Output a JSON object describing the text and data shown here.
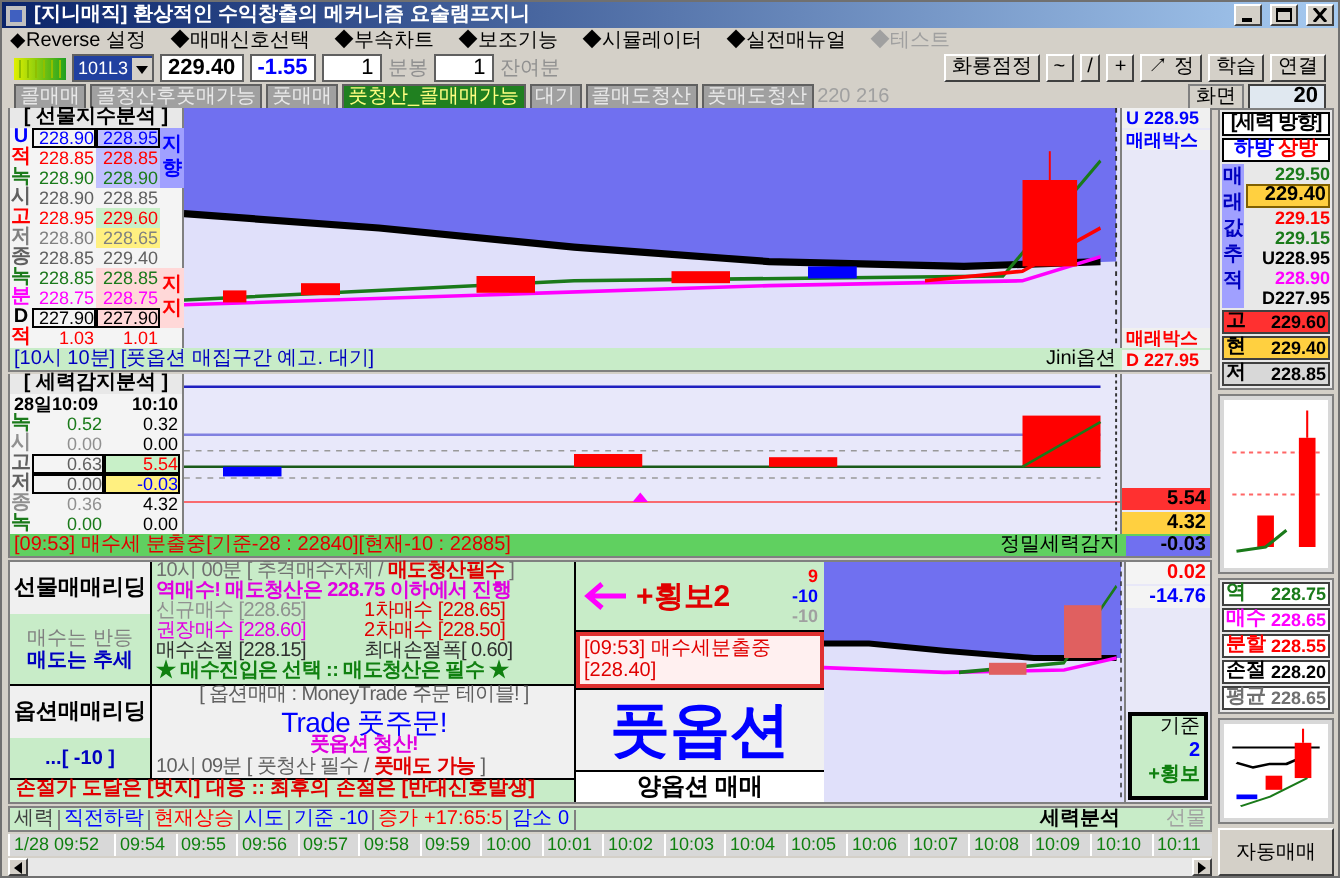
{
  "window": {
    "title": "[지니매직] 환상적인 수익창출의 메커니즘 요술램프지니"
  },
  "menu": [
    {
      "label": "◆Reverse 설정",
      "disabled": false
    },
    {
      "label": "◆매매신호선택",
      "disabled": false
    },
    {
      "label": "◆부속차트",
      "disabled": false
    },
    {
      "label": "◆보조기능",
      "disabled": false
    },
    {
      "label": "◆시뮬레이터",
      "disabled": false
    },
    {
      "label": "◆실전매뉴얼",
      "disabled": false
    },
    {
      "label": "◆테스트",
      "disabled": true
    }
  ],
  "toolbar": {
    "symbol": "101L3",
    "price": "229.40",
    "change": "-1.55",
    "interval": "1",
    "interval_unit": "분봉",
    "remaining": "1",
    "remaining_unit": "잔여분",
    "buttons": [
      "화룡점정",
      "~",
      "/",
      "+",
      "↗ 정",
      "학습",
      "연결"
    ]
  },
  "signals": {
    "items": [
      {
        "label": "콜매매",
        "selected": false
      },
      {
        "label": "콜청산후풋매가능",
        "selected": false
      },
      {
        "label": "풋매매",
        "selected": false
      },
      {
        "label": "풋청산_콜매매가능",
        "selected": true
      },
      {
        "label": "대기",
        "selected": false
      },
      {
        "label": "콜매도청산",
        "selected": false
      },
      {
        "label": "풋매도청산",
        "selected": false
      }
    ],
    "code": "220 216"
  },
  "screen": {
    "label": "화면",
    "value": "20"
  },
  "futures_panel": {
    "title": "[ 선물지수분석 ]",
    "rows": [
      {
        "label": "U",
        "values": [
          "228.90",
          "228.95"
        ],
        "color": "#0000ff"
      },
      {
        "label": "적",
        "values": [
          "228.85",
          "228.85"
        ],
        "color": "#ff0000"
      },
      {
        "label": "녹",
        "values": [
          "228.90",
          "228.90"
        ],
        "color": "#1a7a1a"
      },
      {
        "label": "시",
        "values": [
          "228.90",
          "228.85"
        ],
        "color": "#606060"
      },
      {
        "label": "고",
        "values": [
          "228.95",
          "229.60"
        ],
        "color": "#ff0000"
      },
      {
        "label": "저",
        "values": [
          "228.80",
          "228.65"
        ],
        "color": "#808080"
      },
      {
        "label": "종",
        "values": [
          "228.85",
          "229.40"
        ],
        "color": "#606060"
      },
      {
        "label": "녹",
        "values": [
          "228.85",
          "228.85"
        ],
        "color": "#1a7a1a"
      },
      {
        "label": "분",
        "values": [
          "228.75",
          "228.75"
        ],
        "color": "#ff00ff"
      },
      {
        "label": "D",
        "values": [
          "227.90",
          "227.90"
        ],
        "color": "#000000"
      },
      {
        "label": "적",
        "values": [
          "1.03",
          "1.01"
        ],
        "color": "#ff0000"
      }
    ],
    "side_labels": [
      "지향",
      "지지"
    ],
    "readings": [
      {
        "text": "U 228.95",
        "color": "#0000ff"
      },
      {
        "text": "매래박스",
        "color": "#0000ff"
      },
      {
        "text": "매래박스",
        "color": "#ff0000"
      }
    ],
    "status": "[10시 10분] [풋옵션 매집구간 예고. 대기]",
    "status_right": "Jini옵션",
    "status_reading": "D 227.95"
  },
  "force_panel": {
    "title": "[ 세력감지분석 ]",
    "header": [
      "28일10:09",
      "10:10"
    ],
    "rows": [
      {
        "label": "녹",
        "values": [
          "0.52",
          "0.32"
        ],
        "color": "#1a7a1a"
      },
      {
        "label": "시",
        "values": [
          "0.00",
          "0.00"
        ],
        "color": "#909090"
      },
      {
        "label": "고",
        "values": [
          "0.63",
          "5.54"
        ],
        "color": "#606060"
      },
      {
        "label": "저",
        "values": [
          "0.00",
          "-0.03"
        ],
        "color": "#606060"
      },
      {
        "label": "종",
        "values": [
          "0.36",
          "4.32"
        ],
        "color": "#909090"
      },
      {
        "label": "녹",
        "values": [
          "0.00",
          "0.00"
        ],
        "color": "#1a7a1a"
      }
    ],
    "readings": [
      {
        "text": "5.54",
        "color": "#ff3030"
      },
      {
        "text": "4.32",
        "color": "#ffd040"
      }
    ],
    "status": "[09:53] 매수세 분출중[기준-28 : 22840][현재-10 : 22885]",
    "status_right": "정밀세력감지",
    "status_reading": {
      "text": "-0.03",
      "color": "#7070f0"
    }
  },
  "leading": [
    {
      "title": "선물매매리딩",
      "lines": [
        "매수는 반등",
        "매도는 추세"
      ]
    },
    {
      "title": "옵션매매리딩",
      "lines": [
        "...[ -10 ]"
      ]
    }
  ],
  "futures_box": {
    "header": "10시 00분 [ 추격매수자제 / **매도청산필수** ]",
    "alert": "역매수! 매도청산은 228.75 이하에서 진행",
    "levels": [
      {
        "text": "신규매수 [228.65]",
        "color": "#909090"
      },
      {
        "text": "1차매수 [228.65]",
        "color": "#e00000"
      },
      {
        "text": "권장매수 [228.60]",
        "color": "#e000e0"
      },
      {
        "text": "2차매수 [228.50]",
        "color": "#e00000"
      },
      {
        "text": "매수손절 [228.15]",
        "color": "#303030"
      },
      {
        "text": "최대손절폭[ 0.60]",
        "color": "#303030"
      }
    ],
    "footer": "★ 매수진입은 선택 :: 매도청산은 필수 ★"
  },
  "options_box": {
    "title": "[ 옵션매매 : MoneyTrade 주문 테이블! ]",
    "main": "Trade 풋주문!",
    "sub": "풋옵션 청산!",
    "footer": "10시 09분 [ 풋청산 필수 / **풋매도 가능** ]"
  },
  "stop_line": "손절가 도달은 [벗지] 대응 :: 최후의 손절은 [반대신호발생]",
  "trend_box": {
    "label": "+횡보2",
    "numbers": [
      {
        "text": "9",
        "color": "#ff0000"
      },
      {
        "text": "-10",
        "color": "#0000ff"
      },
      {
        "text": "-10",
        "color": "#a0a0a0"
      }
    ]
  },
  "alert_box": "[09:53] 매수세분출중[228.40]",
  "big_label": "풋옵션",
  "bottom_label": "양옵션 매매",
  "bottom_readings": [
    {
      "text": "0.02",
      "color": "#ff0000"
    },
    {
      "text": "-14.76",
      "color": "#0000ff"
    }
  ],
  "base_box": {
    "title": "기준",
    "value": "2",
    "label": "+횡보"
  },
  "status": {
    "segments": [
      {
        "text": "세력",
        "color": "#404040"
      },
      {
        "text": "직전하락",
        "color": "#0000ff"
      },
      {
        "text": "현재상승",
        "color": "#ff0000"
      },
      {
        "text": "시도",
        "color": "#0000ff"
      },
      {
        "text": "기준 -10",
        "color": "#0000ff"
      },
      {
        "text": "증가 +17:65:5",
        "color": "#ff0000"
      },
      {
        "text": "감소 0",
        "color": "#0000ff"
      }
    ],
    "right": "세력분석",
    "right_disabled": "선물"
  },
  "time_axis": [
    "1/28 09:52",
    "09:54",
    "09:55",
    "09:56",
    "09:57",
    "09:58",
    "09:59",
    "10:00",
    "10:01",
    "10:02",
    "10:03",
    "10:04",
    "10:05",
    "10:06",
    "10:07",
    "10:08",
    "10:09",
    "10:10",
    "10:11"
  ],
  "direction_panel": {
    "title": "[세력 방향]",
    "direction": [
      {
        "text": "하방",
        "color": "#0000ff"
      },
      {
        "text": "상방",
        "color": "#ff0000"
      }
    ],
    "track_label": "매래값추적",
    "values": [
      {
        "text": "229.50",
        "color": "#1a7a1a",
        "highlighted": false
      },
      {
        "text": "229.40",
        "highlighted": true
      },
      {
        "text": "229.15",
        "color": "#ff0000",
        "highlighted": false
      },
      {
        "text": "229.15",
        "color": "#1a7a1a",
        "highlighted": false
      },
      {
        "text": "U228.95",
        "color": "#000000",
        "highlighted": false
      },
      {
        "text": "228.90",
        "color": "#ff00ff",
        "highlighted": false
      },
      {
        "text": "D227.95",
        "color": "#000000",
        "highlighted": false
      }
    ],
    "hilo": [
      {
        "label": "고",
        "value": "229.60",
        "color": "#ff3030"
      },
      {
        "label": "현",
        "value": "229.40",
        "color": "#ffd040"
      },
      {
        "label": "저",
        "value": "228.85",
        "color": "#d8d8d8"
      }
    ]
  },
  "orders": [
    {
      "label": "역",
      "value": "228.75",
      "color": "#1a7a1a"
    },
    {
      "label": "매수",
      "value": "228.65",
      "color": "#ff00ff"
    },
    {
      "label": "분할",
      "value": "228.55",
      "color": "#ff0000"
    },
    {
      "label": "손절",
      "value": "228.20",
      "color": "#000000"
    },
    {
      "label": "평균",
      "value": "228.65",
      "color": "#707070"
    }
  ],
  "auto_button": "자동매매"
}
